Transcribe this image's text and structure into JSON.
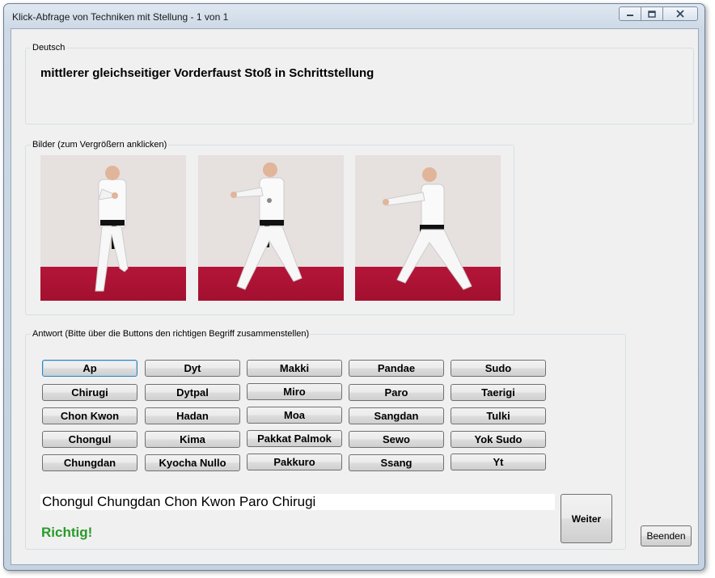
{
  "window": {
    "title": "Klick-Abfrage von Techniken mit Stellung - 1 von 1",
    "controls": [
      "minimize-icon",
      "maximize-icon",
      "close-icon"
    ]
  },
  "deutsch": {
    "label": "Deutsch",
    "text": "mittlerer gleichseitiger Vorderfaust Stoß in Schrittstellung"
  },
  "bilder": {
    "label": "Bilder (zum Vergrößern anklicken)",
    "images": [
      "front-stance-front-view",
      "front-stance-diagonal-view",
      "front-stance-side-view"
    ]
  },
  "antwort": {
    "label": "Antwort (Bitte über die Buttons den richtigen Begriff zusammenstellen)",
    "buttons": [
      "Ap",
      "Dyt",
      "Makki",
      "Pandae",
      "Sudo",
      "Chirugi",
      "Dytpal",
      "Miro",
      "Paro",
      "Taerigi",
      "Chon Kwon",
      "Hadan",
      "Moa",
      "Sangdan",
      "Tulki",
      "Chongul",
      "Kima",
      "Pakkat Palmok",
      "Sewo",
      "Yok Sudo",
      "Chungdan",
      "Kyocha Nullo",
      "Pakkuro",
      "Ssang",
      "Yt"
    ],
    "answer": "Chongul Chungdan Chon Kwon Paro Chirugi",
    "result": "Richtig!",
    "result_color": "#2a9a2a"
  },
  "actions": {
    "weiter": "Weiter",
    "beenden": "Beenden"
  }
}
